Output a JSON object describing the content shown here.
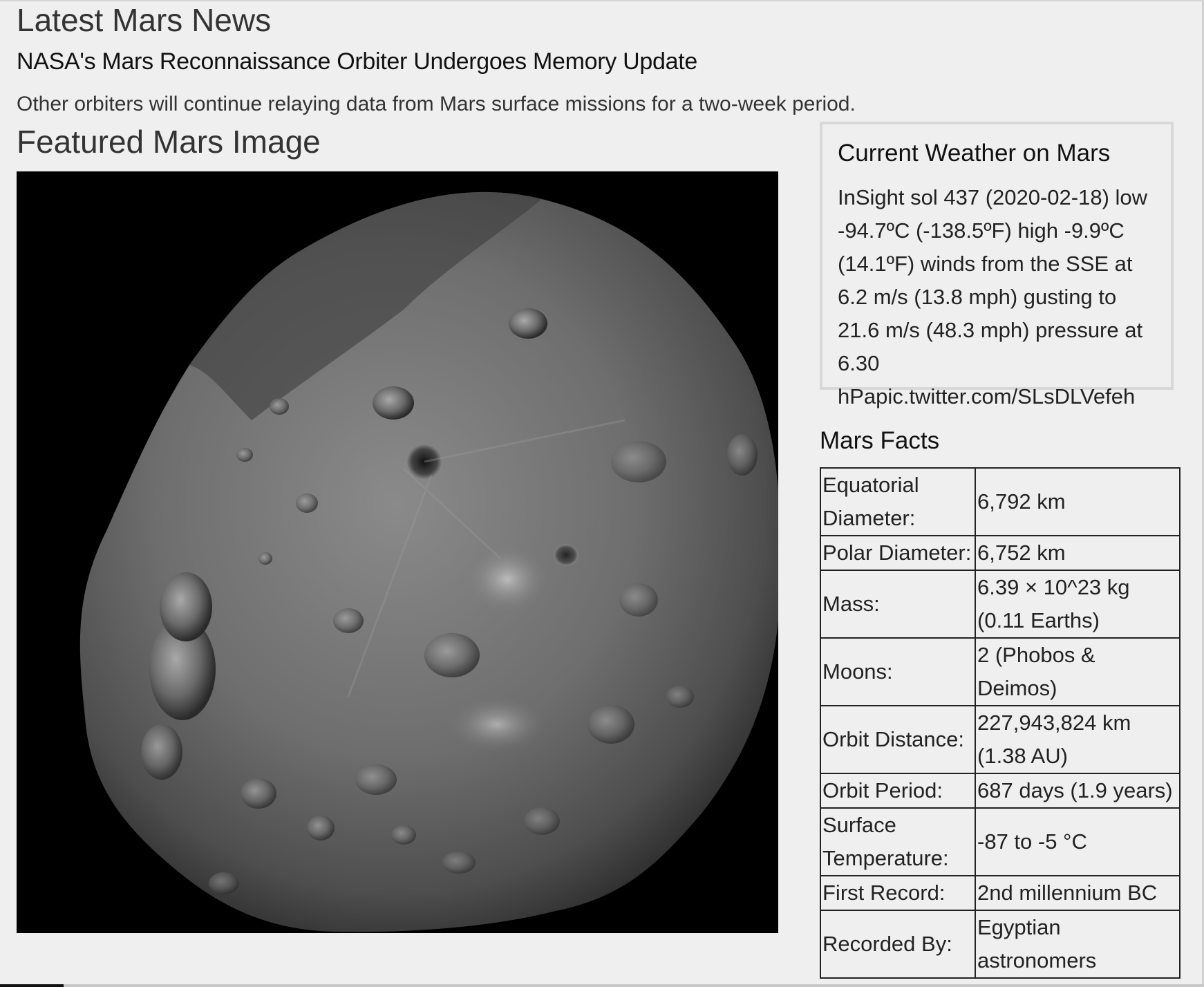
{
  "news": {
    "section_title": "Latest Mars News",
    "headline": "NASA's Mars Reconnaissance Orbiter Undergoes Memory Update",
    "teaser": "Other orbiters will continue relaying data from Mars surface missions for a two-week period."
  },
  "featured": {
    "section_title": "Featured Mars Image"
  },
  "weather": {
    "title": "Current Weather on Mars",
    "text": "InSight sol 437 (2020-02-18) low -94.7ºC (-138.5ºF) high -9.9ºC (14.1ºF) winds from the SSE at 6.2 m/s (13.8 mph) gusting to 21.6 m/s (48.3 mph) pressure at 6.30 hPapic.twitter.com/SLsDLVefeh"
  },
  "facts": {
    "title": "Mars Facts",
    "rows": [
      {
        "label": "Equatorial Diameter:",
        "value": "6,792 km"
      },
      {
        "label": "Polar Diameter:",
        "value": "6,752 km"
      },
      {
        "label": "Mass:",
        "value": "6.39 × 10^23 kg (0.11 Earths)"
      },
      {
        "label": "Moons:",
        "value": "2 (Phobos & Deimos)"
      },
      {
        "label": "Orbit Distance:",
        "value": "227,943,824 km (1.38 AU)"
      },
      {
        "label": "Orbit Period:",
        "value": "687 days (1.9 years)"
      },
      {
        "label": "Surface Temperature:",
        "value": "-87 to -5 °C"
      },
      {
        "label": "First Record:",
        "value": "2nd millennium BC"
      },
      {
        "label": "Recorded By:",
        "value": "Egyptian astronomers"
      }
    ]
  }
}
